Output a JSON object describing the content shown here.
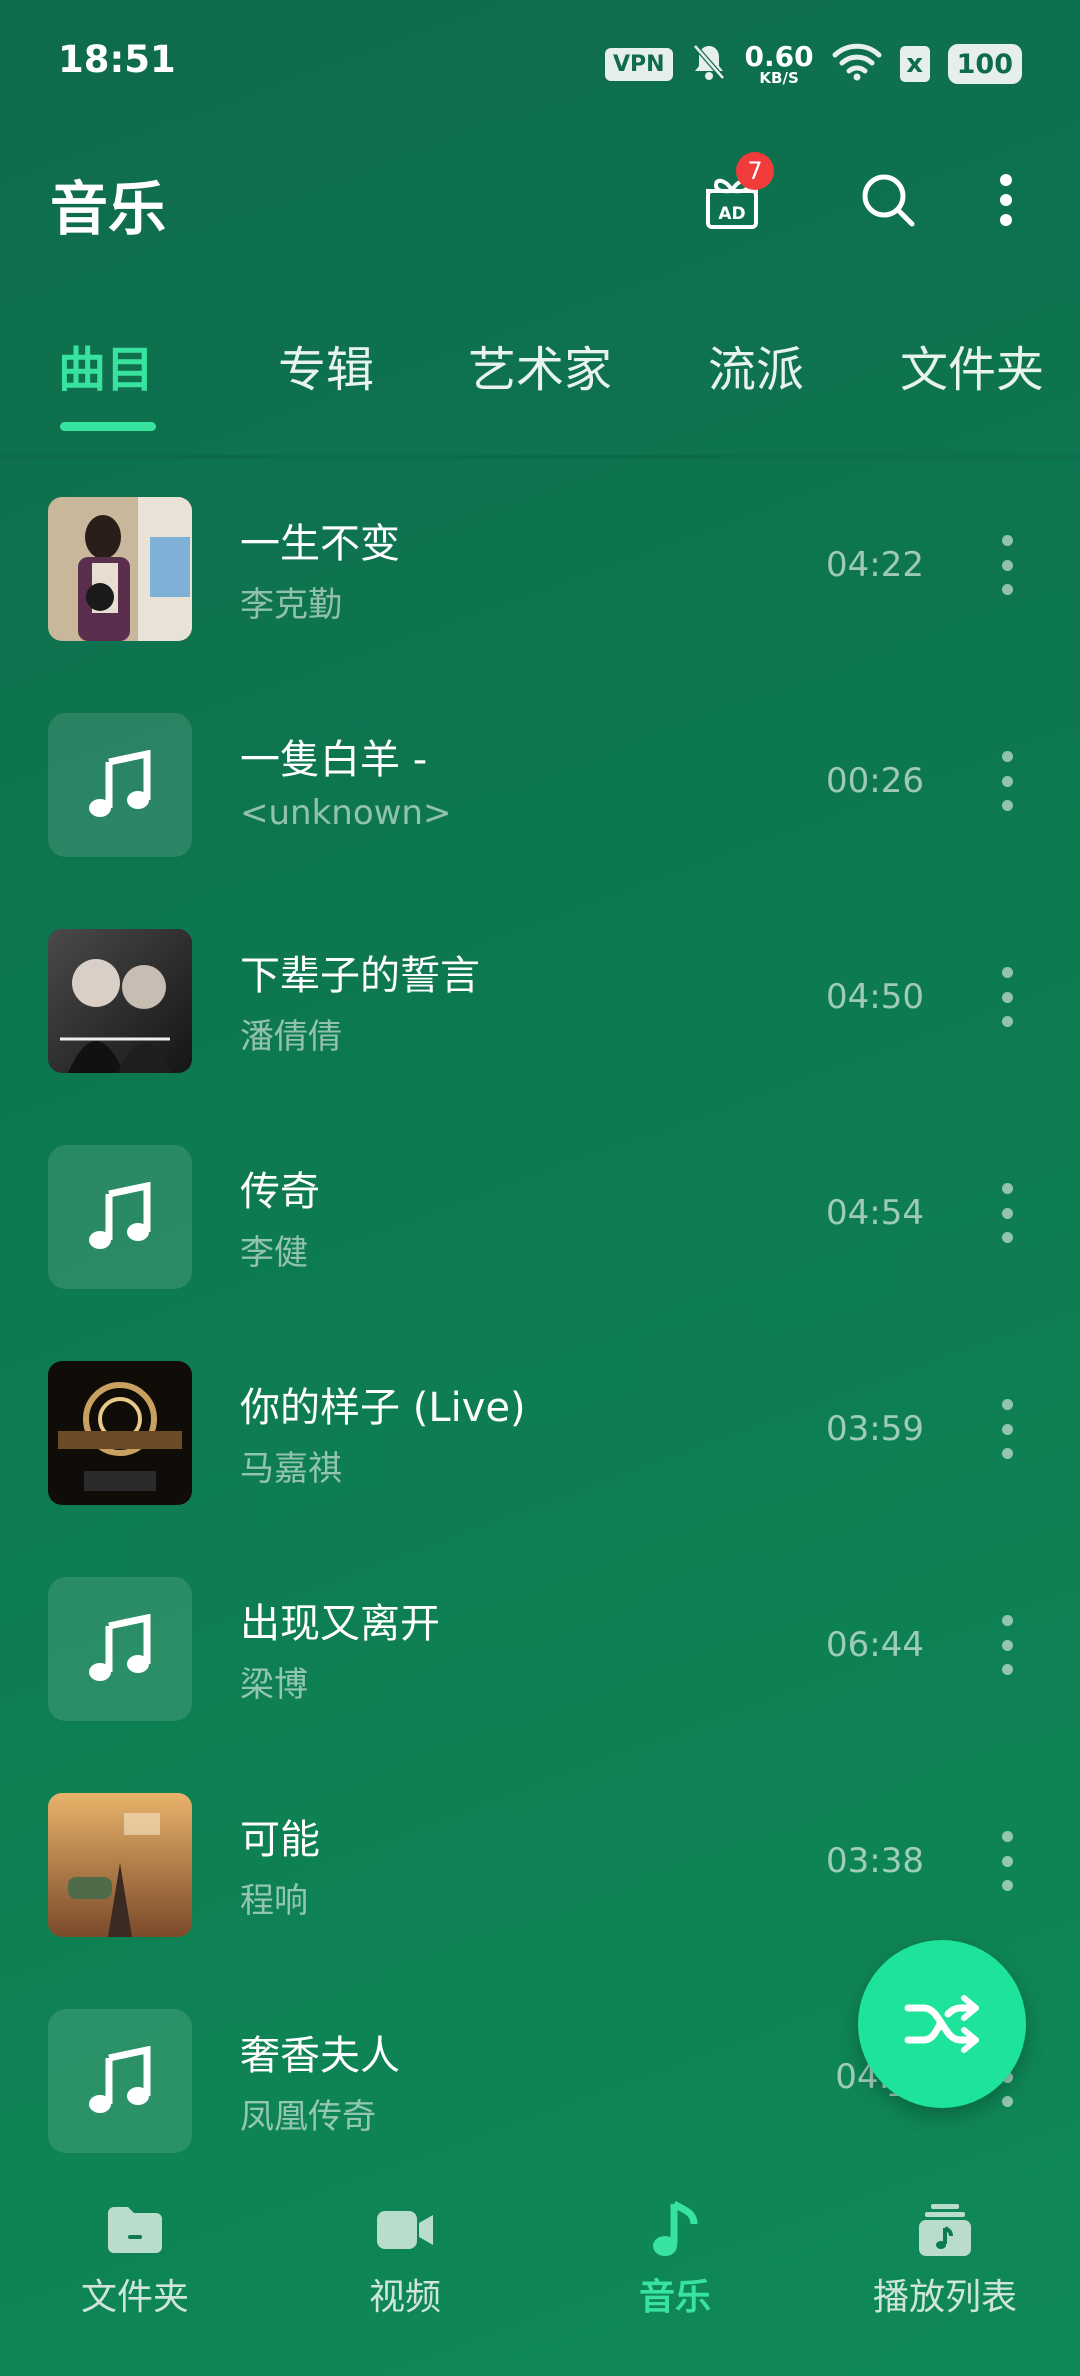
{
  "status_bar": {
    "time": "18:51",
    "vpn_label": "VPN",
    "speed_value": "0.60",
    "speed_unit": "KB/S",
    "sim_label": "x",
    "battery": "100"
  },
  "header": {
    "title": "音乐",
    "ad_label": "AD",
    "gift_badge": "7"
  },
  "tabs": [
    {
      "label": "曲目",
      "active": true
    },
    {
      "label": "专辑",
      "active": false
    },
    {
      "label": "艺术家",
      "active": false
    },
    {
      "label": "流派",
      "active": false
    },
    {
      "label": "文件夹",
      "active": false
    }
  ],
  "tracks": [
    {
      "title": "一生不变",
      "artist": "李克勤",
      "duration": "04:22",
      "has_cover": true
    },
    {
      "title": "一隻白羊 -",
      "artist": "<unknown>",
      "duration": "00:26",
      "has_cover": false
    },
    {
      "title": "下辈子的誓言",
      "artist": "潘倩倩",
      "duration": "04:50",
      "has_cover": true
    },
    {
      "title": "传奇",
      "artist": "李健",
      "duration": "04:54",
      "has_cover": false
    },
    {
      "title": "你的样子 (Live)",
      "artist": "马嘉祺",
      "duration": "03:59",
      "has_cover": true
    },
    {
      "title": "出现又离开",
      "artist": "梁博",
      "duration": "06:44",
      "has_cover": false
    },
    {
      "title": "可能",
      "artist": "程响",
      "duration": "03:38",
      "has_cover": true
    },
    {
      "title": "奢香夫人",
      "artist": "凤凰传奇",
      "duration": "04:__",
      "has_cover": false
    }
  ],
  "bottom_nav": [
    {
      "label": "文件夹",
      "icon": "folder-icon",
      "active": false
    },
    {
      "label": "视频",
      "icon": "video-icon",
      "active": false
    },
    {
      "label": "音乐",
      "icon": "music-note-icon",
      "active": true
    },
    {
      "label": "播放列表",
      "icon": "playlist-icon",
      "active": false
    }
  ],
  "colors": {
    "accent": "#38e3a0",
    "fab": "#1ee39a",
    "background": "#0d7a50",
    "badge": "#f23b3b"
  }
}
